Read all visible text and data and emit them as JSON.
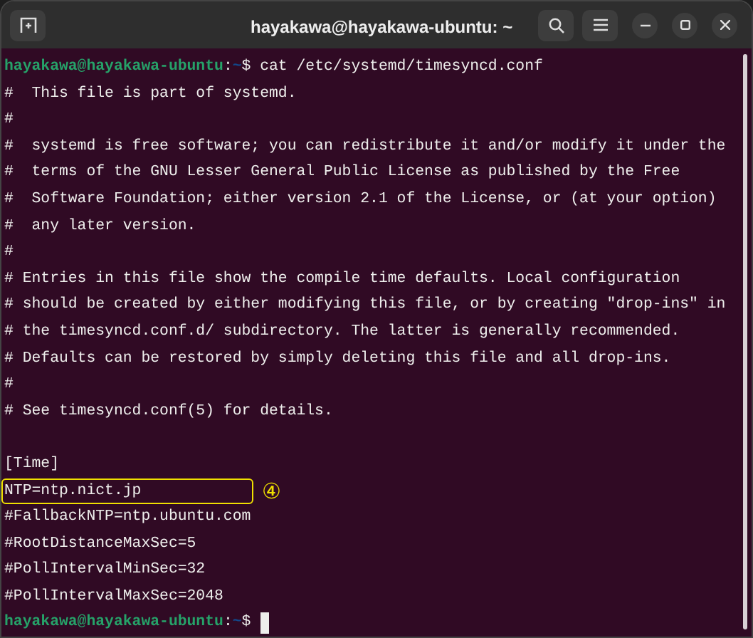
{
  "window": {
    "title": "hayakawa@hayakawa-ubuntu: ~"
  },
  "terminal": {
    "lines": [
      {
        "kind": "prompt",
        "user_host": "hayakawa@hayakawa-ubuntu",
        "separator": ":",
        "path": "~",
        "symbol": "$",
        "command": "cat /etc/systemd/timesyncd.conf"
      },
      {
        "kind": "text",
        "text": "#  This file is part of systemd."
      },
      {
        "kind": "text",
        "text": "#"
      },
      {
        "kind": "text",
        "text": "#  systemd is free software; you can redistribute it and/or modify it under the"
      },
      {
        "kind": "text",
        "text": "#  terms of the GNU Lesser General Public License as published by the Free"
      },
      {
        "kind": "text",
        "text": "#  Software Foundation; either version 2.1 of the License, or (at your option)"
      },
      {
        "kind": "text",
        "text": "#  any later version."
      },
      {
        "kind": "text",
        "text": "#"
      },
      {
        "kind": "text",
        "text": "# Entries in this file show the compile time defaults. Local configuration"
      },
      {
        "kind": "text",
        "text": "# should be created by either modifying this file, or by creating \"drop-ins\" in"
      },
      {
        "kind": "text",
        "text": "# the timesyncd.conf.d/ subdirectory. The latter is generally recommended."
      },
      {
        "kind": "text",
        "text": "# Defaults can be restored by simply deleting this file and all drop-ins."
      },
      {
        "kind": "text",
        "text": "#"
      },
      {
        "kind": "text",
        "text": "# See timesyncd.conf(5) for details."
      },
      {
        "kind": "blank"
      },
      {
        "kind": "text",
        "text": "[Time]"
      },
      {
        "kind": "text",
        "text": "NTP=ntp.nict.jp",
        "highlighted": true,
        "callout": "④"
      },
      {
        "kind": "text",
        "text": "#FallbackNTP=ntp.ubuntu.com"
      },
      {
        "kind": "text",
        "text": "#RootDistanceMaxSec=5"
      },
      {
        "kind": "text",
        "text": "#PollIntervalMinSec=32"
      },
      {
        "kind": "text",
        "text": "#PollIntervalMaxSec=2048"
      },
      {
        "kind": "prompt",
        "user_host": "hayakawa@hayakawa-ubuntu",
        "separator": ":",
        "path": "~",
        "symbol": "$",
        "cursor": true
      }
    ]
  }
}
